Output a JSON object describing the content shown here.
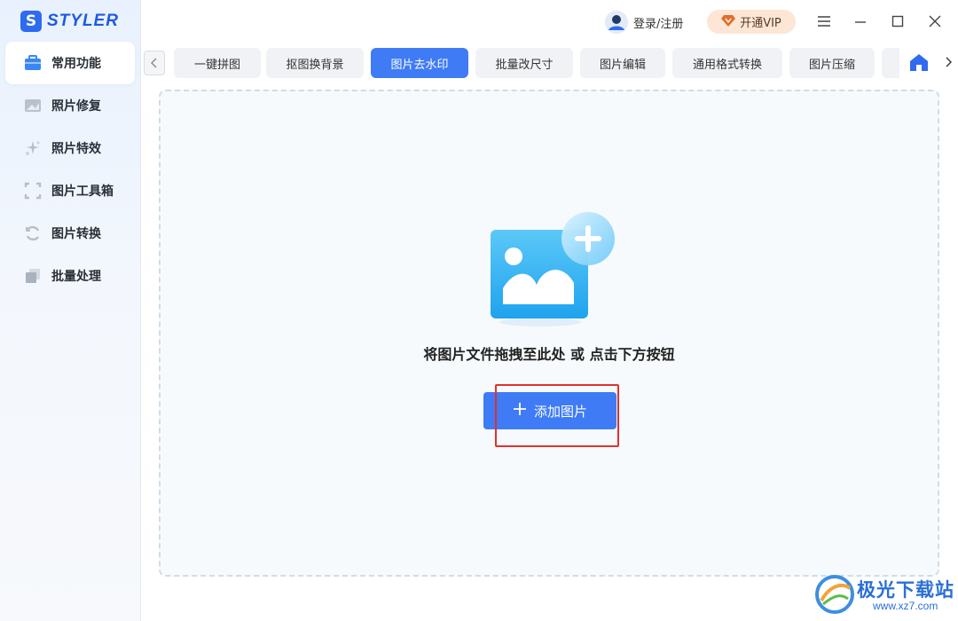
{
  "app": {
    "logo_letter": "S",
    "name": "STYLER"
  },
  "titlebar": {
    "user_label": "登录/注册",
    "vip_label": "开通VIP",
    "menu_icon": "hamburger-icon",
    "minimize_icon": "minimize-icon",
    "maximize_icon": "maximize-icon",
    "close_icon": "close-icon"
  },
  "sidebar": {
    "items": [
      {
        "label": "常用功能",
        "icon": "toolbox-icon",
        "active": true
      },
      {
        "label": "照片修复",
        "icon": "photo-repair-icon",
        "active": false
      },
      {
        "label": "照片特效",
        "icon": "sparkle-icon",
        "active": false
      },
      {
        "label": "图片工具箱",
        "icon": "crop-frame-icon",
        "active": false
      },
      {
        "label": "图片转换",
        "icon": "convert-icon",
        "active": false
      },
      {
        "label": "批量处理",
        "icon": "layers-icon",
        "active": false
      }
    ]
  },
  "tabs": {
    "items": [
      {
        "label": "一键拼图",
        "active": false
      },
      {
        "label": "抠图换背景",
        "active": false
      },
      {
        "label": "图片去水印",
        "active": true
      },
      {
        "label": "批量改尺寸",
        "active": false
      },
      {
        "label": "图片编辑",
        "active": false
      },
      {
        "label": "通用格式转换",
        "active": false
      },
      {
        "label": "图片压缩",
        "active": false
      },
      {
        "label": "…",
        "active": false
      }
    ]
  },
  "dropzone": {
    "hint": "将图片文件拖拽至此处 或 点击下方按钮",
    "add_button_label": "添加图片"
  },
  "watermark": {
    "text": "极光下载站",
    "url": "www.xz7.com"
  },
  "colors": {
    "accent": "#3f7bf5",
    "highlight": "#e0312e"
  }
}
